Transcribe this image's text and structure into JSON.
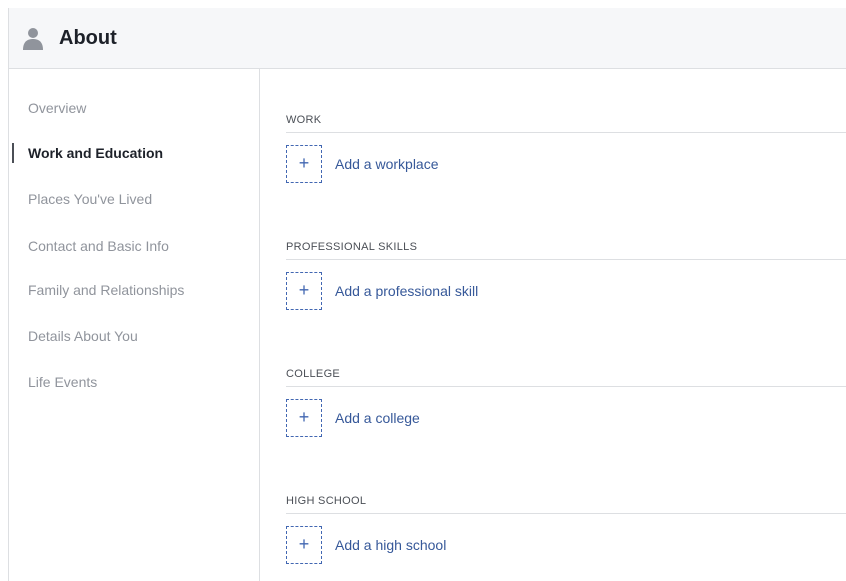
{
  "header": {
    "title": "About",
    "icon": "person-icon"
  },
  "sidebar": {
    "items": [
      {
        "label": "Overview",
        "active": false
      },
      {
        "label": "Work and Education",
        "active": true
      },
      {
        "label": "Places You've Lived",
        "active": false
      },
      {
        "label": "Contact and Basic Info",
        "active": false
      },
      {
        "label": "Family and Relationships",
        "active": false
      },
      {
        "label": "Details About You",
        "active": false
      },
      {
        "label": "Life Events",
        "active": false
      }
    ]
  },
  "sections": [
    {
      "title": "WORK",
      "add_label": "Add a workplace",
      "add_symbol": "+"
    },
    {
      "title": "PROFESSIONAL SKILLS",
      "add_label": "Add a professional skill",
      "add_symbol": "+"
    },
    {
      "title": "COLLEGE",
      "add_label": "Add a college",
      "add_symbol": "+"
    },
    {
      "title": "HIGH SCHOOL",
      "add_label": "Add a high school",
      "add_symbol": "+"
    }
  ],
  "colors": {
    "link": "#365899",
    "accent": "#4267b2",
    "muted_text": "#90949c",
    "active_text": "#1d2129"
  }
}
